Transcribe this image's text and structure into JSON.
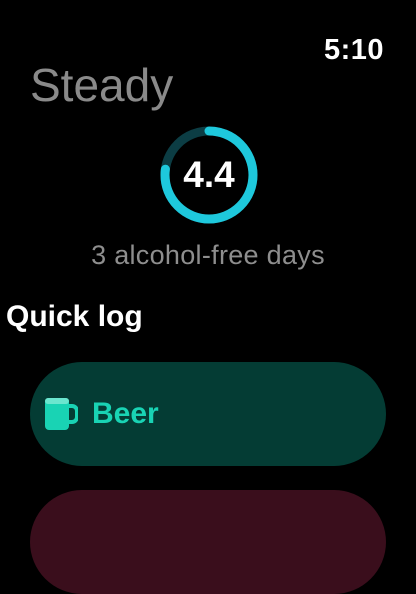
{
  "status": {
    "time": "5:10"
  },
  "header": {
    "title": "Steady"
  },
  "score": {
    "value": "4.4",
    "progress": 0.77
  },
  "summary": {
    "text": "3 alcohol-free days"
  },
  "quick_log": {
    "title": "Quick log",
    "items": [
      {
        "label": "Beer",
        "icon": "beer-mug-icon"
      },
      {
        "label": ""
      }
    ]
  },
  "colors": {
    "ring_active": "#1ec8dc",
    "ring_track": "#0c3d44",
    "beer_button_bg": "#043c34",
    "beer_accent": "#19d3b4",
    "second_button_bg": "#3a0e1c"
  }
}
